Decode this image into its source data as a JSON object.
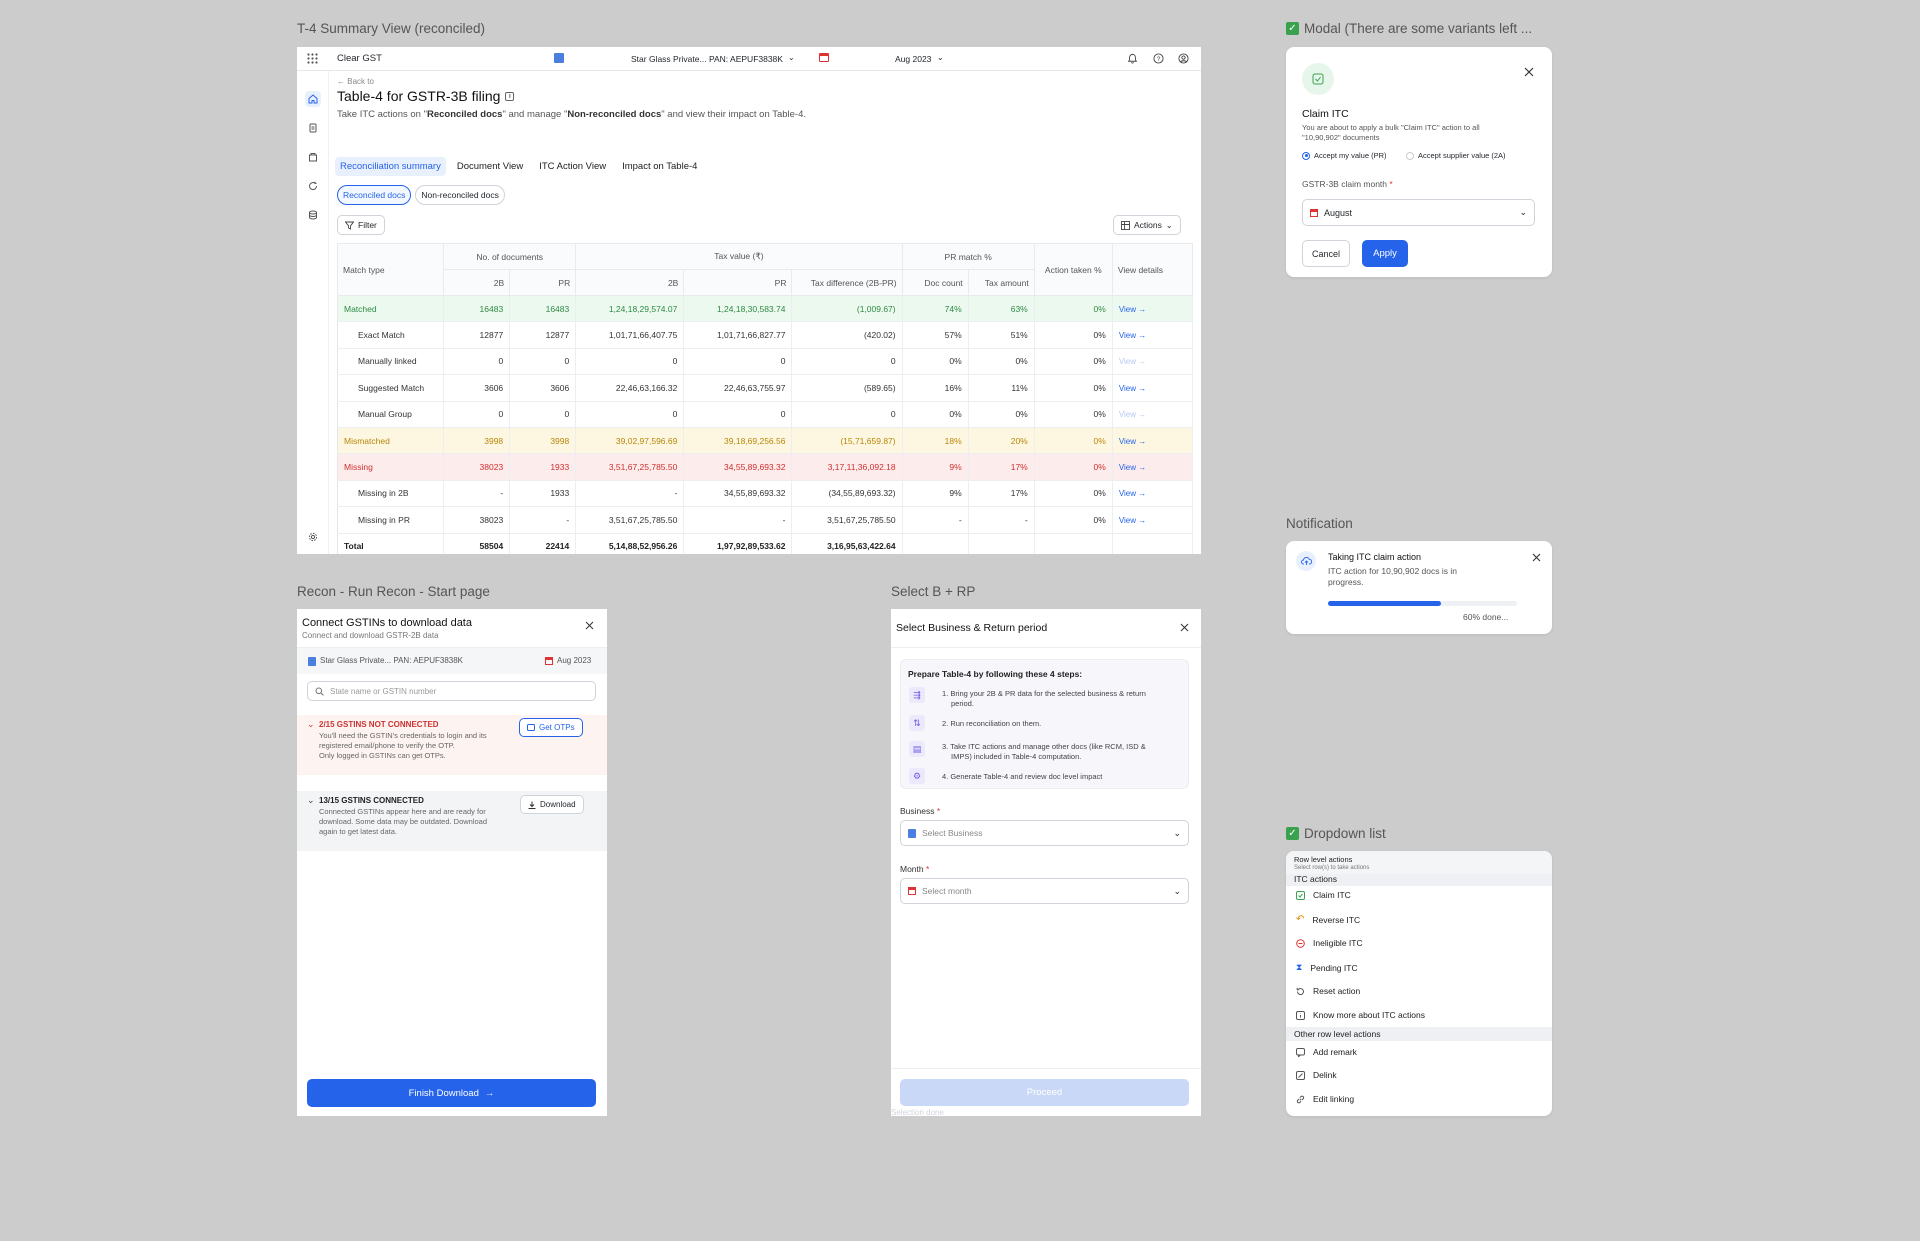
{
  "labels": {
    "frame1": "T-4 Summary View (reconciled)",
    "frame2": "Recon - Run Recon - Start page",
    "frame3": "Select B + RP",
    "modal": "Modal (There are some variants left ...",
    "notification": "Notification",
    "dropdown": "Dropdown list"
  },
  "summary": {
    "app_name": "Clear GST",
    "business": "Star Glass Private... PAN: AEPUF3838K",
    "period": "Aug 2023",
    "back": "Back to",
    "title": "Table-4 for GSTR-3B filing",
    "subtitle_pre": "Take ITC actions on \"",
    "subtitle_b1": "Reconciled docs",
    "subtitle_mid": "\" and manage \"",
    "subtitle_b2": "Non-reconciled docs",
    "subtitle_post": "\" and view their impact on Table-4.",
    "tabs": [
      "Reconciliation summary",
      "Document View",
      "ITC Action View",
      "Impact on Table-4"
    ],
    "chips": [
      "Reconciled docs",
      "Non-reconciled docs"
    ],
    "filter": "Filter",
    "actions": "Actions",
    "table": {
      "h_match_type": "Match type",
      "h_docs": "No. of documents",
      "h_tax": "Tax value (₹)",
      "h_pr_match": "PR match %",
      "h_action": "Action taken %",
      "h_view": "View details",
      "h_2b": "2B",
      "h_pr": "PR",
      "h_taxdiff": "Tax difference (2B-PR)",
      "h_doc_count": "Doc count",
      "h_tax_amount": "Tax amount",
      "rows": [
        {
          "type": "Matched",
          "d2b": "16483",
          "dpr": "16483",
          "t2b": "1,24,18,29,574.07",
          "tpr": "1,24,18,30,583.74",
          "diff": "(1,009.67)",
          "doc": "74%",
          "tax": "63%",
          "act": "0%",
          "view": "View →"
        },
        {
          "type": "Exact Match",
          "d2b": "12877",
          "dpr": "12877",
          "t2b": "1,01,71,66,407.75",
          "tpr": "1,01,71,66,827.77",
          "diff": "(420.02)",
          "doc": "57%",
          "tax": "51%",
          "act": "0%",
          "view": "View →"
        },
        {
          "type": "Manually linked",
          "d2b": "0",
          "dpr": "0",
          "t2b": "0",
          "tpr": "0",
          "diff": "0",
          "doc": "0%",
          "tax": "0%",
          "act": "0%",
          "view": "View →"
        },
        {
          "type": "Suggested Match",
          "d2b": "3606",
          "dpr": "3606",
          "t2b": "22,46,63,166.32",
          "tpr": "22,46,63,755.97",
          "diff": "(589.65)",
          "doc": "16%",
          "tax": "11%",
          "act": "0%",
          "view": "View →"
        },
        {
          "type": "Manual Group",
          "d2b": "0",
          "dpr": "0",
          "t2b": "0",
          "tpr": "0",
          "diff": "0",
          "doc": "0%",
          "tax": "0%",
          "act": "0%",
          "view": "View →"
        },
        {
          "type": "Mismatched",
          "d2b": "3998",
          "dpr": "3998",
          "t2b": "39,02,97,596.69",
          "tpr": "39,18,69,256.56",
          "diff": "(15,71,659.87)",
          "doc": "18%",
          "tax": "20%",
          "act": "0%",
          "view": "View →"
        },
        {
          "type": "Missing",
          "d2b": "38023",
          "dpr": "1933",
          "t2b": "3,51,67,25,785.50",
          "tpr": "34,55,89,693.32",
          "diff": "3,17,11,36,092.18",
          "doc": "9%",
          "tax": "17%",
          "act": "0%",
          "view": "View →"
        },
        {
          "type": "Missing in 2B",
          "d2b": "-",
          "dpr": "1933",
          "t2b": "-",
          "tpr": "34,55,89,693.32",
          "diff": "(34,55,89,693.32)",
          "doc": "9%",
          "tax": "17%",
          "act": "0%",
          "view": "View →"
        },
        {
          "type": "Missing in PR",
          "d2b": "38023",
          "dpr": "-",
          "t2b": "3,51,67,25,785.50",
          "tpr": "-",
          "diff": "3,51,67,25,785.50",
          "doc": "-",
          "tax": "-",
          "act": "0%",
          "view": "View →"
        }
      ],
      "total": {
        "type": "Total",
        "d2b": "58504",
        "dpr": "22414",
        "t2b": "5,14,88,52,956.26",
        "tpr": "1,97,92,89,533.62",
        "diff": "3,16,95,63,422.64"
      }
    }
  },
  "recon": {
    "title": "Connect GSTINs to download data",
    "subtitle": "Connect and download GSTR-2B data",
    "business": "Star Glass Private... PAN: AEPUF3838K",
    "period": "Aug 2023",
    "search_placeholder": "State name or GSTIN number",
    "nc_title": "2/15 GSTINS NOT CONNECTED",
    "nc_line1": "You'll need the GSTIN's credentials to login and its",
    "nc_line2": "registered email/phone to verify the OTP.",
    "nc_line3": "Only logged in GSTINs can get OTPs.",
    "get_otps": "Get OTPs",
    "c_title": "13/15 GSTINS CONNECTED",
    "c_line1": "Connected GSTINs appear here and are ready for",
    "c_line2": "download. Some data may be outdated. Download",
    "c_line3": "again to get latest data.",
    "download": "Download",
    "finish": "Finish Download"
  },
  "select": {
    "title": "Select Business & Return period",
    "steps_title": "Prepare Table-4 by following these 4 steps:",
    "step1a": "1. Bring your 2B & PR data for the selected business & return",
    "step1b": "period.",
    "step2": "2. Run reconciliation on them.",
    "step3a": "3. Take ITC actions and manage other docs (like RCM, ISD &",
    "step3b": "IMPS) included in Table-4 computation.",
    "step4": "4. Generate Table-4 and review doc level impact",
    "business_label": "Business",
    "business_placeholder": "Select Business",
    "month_label": "Month",
    "month_placeholder": "Select month",
    "proceed": "Proceed",
    "note": "Selection done"
  },
  "modal": {
    "title": "Claim ITC",
    "desc1": "You are about to apply a bulk \"Claim ITC\" action to all",
    "desc2": "\"10,90,902\" documents",
    "radio1": "Accept my value (PR)",
    "radio2": "Accept supplier value (2A)",
    "month_label": "GSTR-3B claim month",
    "month_value": "August",
    "cancel": "Cancel",
    "apply": "Apply"
  },
  "notification": {
    "title": "Taking ITC claim action",
    "line1": "ITC action for 10,90,902 docs is in",
    "line2": "progress.",
    "progress": 0.6,
    "progress_text": "60% done..."
  },
  "dropdown": {
    "header": "Row level actions",
    "header_sub": "Select row(s) to take actions",
    "group1": "ITC actions",
    "items1": [
      "Claim ITC",
      "Reverse ITC",
      "Ineligible ITC",
      "Pending ITC",
      "Reset action",
      "Know more about ITC actions"
    ],
    "group2": "Other row level actions",
    "items2": [
      "Add remark",
      "Delink",
      "Edit linking"
    ]
  },
  "colors": {
    "accent": "#2563eb",
    "green": "#2f8a44",
    "amber": "#b8860b",
    "red": "#cf2f2f"
  }
}
